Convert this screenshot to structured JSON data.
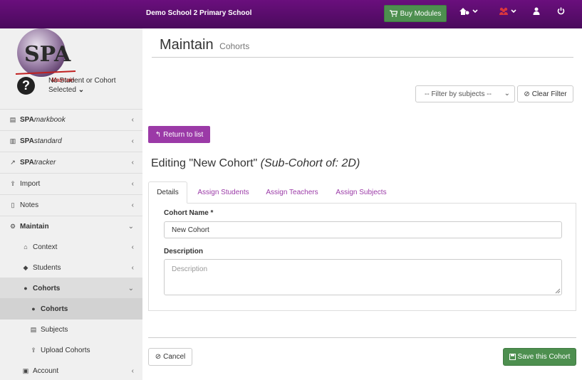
{
  "header": {
    "school": "Demo School 2 Primary School",
    "buy_label": "Buy Modules"
  },
  "sidebar": {
    "logo_text": "SPA",
    "logo_sub": "Maintain",
    "no_selection_line1": "No Student or Cohort",
    "no_selection_line2": "Selected",
    "items": [
      {
        "prefix": "SPA",
        "suffix": "markbook"
      },
      {
        "prefix": "SPA",
        "suffix": "standard"
      },
      {
        "prefix": "SPA",
        "suffix": "tracker"
      },
      {
        "label": "Import"
      },
      {
        "label": "Notes"
      },
      {
        "label": "Maintain"
      },
      {
        "label": "Context"
      },
      {
        "label": "Students"
      },
      {
        "label": "Cohorts"
      },
      {
        "label": "Cohorts"
      },
      {
        "label": "Subjects"
      },
      {
        "label": "Upload Cohorts"
      },
      {
        "label": "Account"
      }
    ]
  },
  "main": {
    "title": "Maintain",
    "subtitle": "Cohorts",
    "filter_placeholder": "-- Filter by subjects --",
    "clear_filter": "Clear Filter",
    "return_label": "Return to list",
    "editing_prefix": "Editing \"New Cohort\"",
    "editing_sub": "(Sub-Cohort of: 2D)",
    "tabs": [
      "Details",
      "Assign Students",
      "Assign Teachers",
      "Assign Subjects"
    ],
    "name_label": "Cohort Name *",
    "name_value": "New Cohort",
    "desc_label": "Description",
    "desc_placeholder": "Description",
    "cancel_label": "Cancel",
    "save_label": "Save this Cohort"
  },
  "colors": {
    "header": "#5b0d6e",
    "accent": "#9b3aa7",
    "success": "#4d8f4f"
  }
}
